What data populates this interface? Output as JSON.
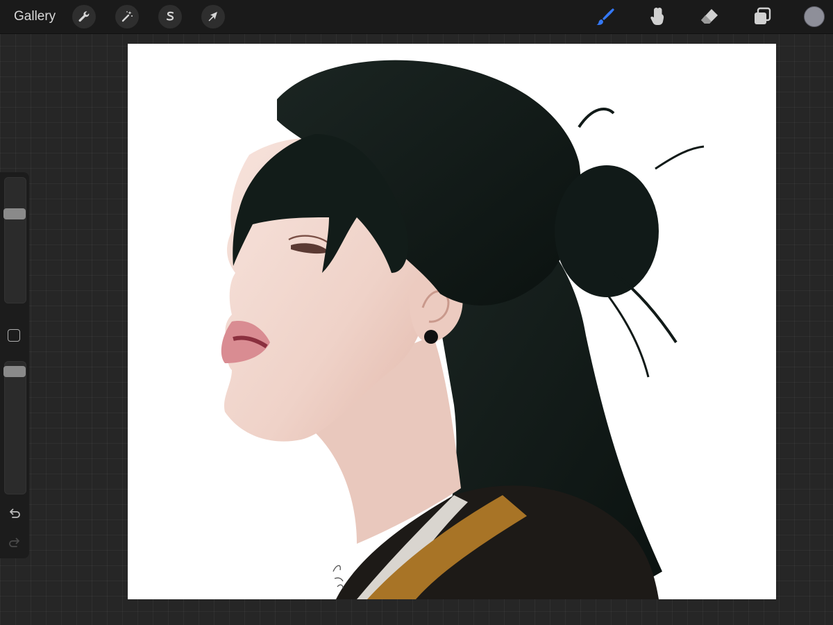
{
  "app": {
    "gallery_label": "Gallery"
  },
  "toolbar_left": [
    {
      "name": "actions-wrench-icon"
    },
    {
      "name": "adjustments-wand-icon"
    },
    {
      "name": "selection-s-icon"
    },
    {
      "name": "transform-arrow-icon"
    }
  ],
  "toolbar_right": {
    "active_tool": "brush",
    "accent_color": "#3478f6",
    "icon_color": "#d0d0d0",
    "current_color": "#8e8f99"
  },
  "sidebar": {
    "brush_size_level": 0.73,
    "opacity_level": 0.96
  },
  "artwork": {
    "background": "#ffffff",
    "hair_color": "#101a17",
    "skin_color": "#f3d9d1",
    "collar_gold": "#a87426",
    "robe_color": "#1d1a17"
  }
}
